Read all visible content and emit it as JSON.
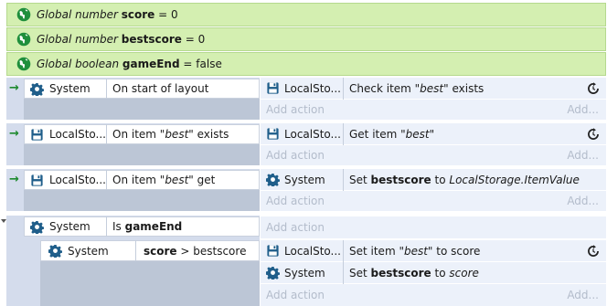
{
  "globals": [
    {
      "prefix": "Global number",
      "name": "score",
      "suffix": "= 0"
    },
    {
      "prefix": "Global number",
      "name": "bestscore",
      "suffix": "= 0"
    },
    {
      "prefix": "Global boolean",
      "name": "gameEnd",
      "suffix": "= false"
    }
  ],
  "events": [
    {
      "cond_object": "System",
      "cond_text": "On start of layout",
      "act_object": "LocalSto...",
      "act_text_pre": "Check item ",
      "act_text_italic": "\"best\"",
      "act_text_post": " exists",
      "add_action": "Add action",
      "add_dots": "Add..."
    },
    {
      "cond_object": "LocalSto...",
      "cond_text_pre": "On item ",
      "cond_text_italic": "\"best\"",
      "cond_text_post": " exists",
      "act_object": "LocalSto...",
      "act_text_pre": "Get item ",
      "act_text_italic": "\"best\"",
      "add_action": "Add action",
      "add_dots": "Add..."
    },
    {
      "cond_object": "LocalSto...",
      "cond_text_pre": "On item ",
      "cond_text_italic": "\"best\"",
      "cond_text_post": " get",
      "act_object": "System",
      "act_text_pre": "Set ",
      "act_text_bold": "bestscore",
      "act_text_mid": " to ",
      "act_text_italic": "LocalStorage.ItemValue",
      "add_action": "Add action",
      "add_dots": "Add..."
    },
    {
      "cond_object": "System",
      "cond_text_pre": "Is ",
      "cond_text_bold": "gameEnd",
      "add_action": "Add action"
    }
  ],
  "subevent": {
    "cond_object": "System",
    "cond_text_bold": "score",
    "cond_text_post": " > bestscore",
    "act1_object": "LocalSto...",
    "act1_text_pre": "Set item ",
    "act1_text_italic": "\"best\"",
    "act1_text_post": " to score",
    "act2_object": "System",
    "act2_text_pre": "Set ",
    "act2_text_bold": "bestscore",
    "act2_text_mid": " to ",
    "act2_text_italic": "score",
    "add_action": "Add action",
    "add_dots": "Add..."
  },
  "colors": {
    "global_bg": "#d4efb1",
    "event_bg": "#ecf1fa",
    "condition_strip": "#d4dcec",
    "trigger_arrow": "#1e8a2e"
  }
}
